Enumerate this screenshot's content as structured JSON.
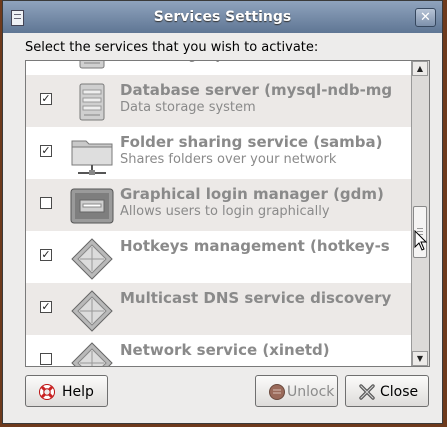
{
  "window": {
    "title": "Services Settings"
  },
  "prompt": "Select the services that you wish to activate:",
  "services": [
    {
      "name": "",
      "description": "Data storage system",
      "checked": true,
      "icon": "database-icon"
    },
    {
      "name": "Database server (mysql-ndb-mg",
      "description": "Data storage system",
      "checked": true,
      "icon": "database-icon"
    },
    {
      "name": "Folder sharing service (samba)",
      "description": "Shares folders over your network",
      "checked": true,
      "icon": "network-folder-icon"
    },
    {
      "name": "Graphical login manager (gdm)",
      "description": "Allows users to login graphically",
      "checked": false,
      "icon": "login-screen-icon"
    },
    {
      "name": "Hotkeys management (hotkey-s",
      "description": "",
      "checked": true,
      "icon": "service-diamond-icon"
    },
    {
      "name": "Multicast DNS service discovery",
      "description": "",
      "checked": true,
      "icon": "service-diamond-icon"
    },
    {
      "name": "Network service (xinetd)",
      "description": "",
      "checked": false,
      "icon": "service-diamond-icon"
    }
  ],
  "buttons": {
    "help": "Help",
    "unlock": "Unlock",
    "close": "Close"
  },
  "colors": {
    "titlebar": "#6f86a6",
    "row_alt": "#ece9e7",
    "disabled_text": "#8a8a8a"
  }
}
